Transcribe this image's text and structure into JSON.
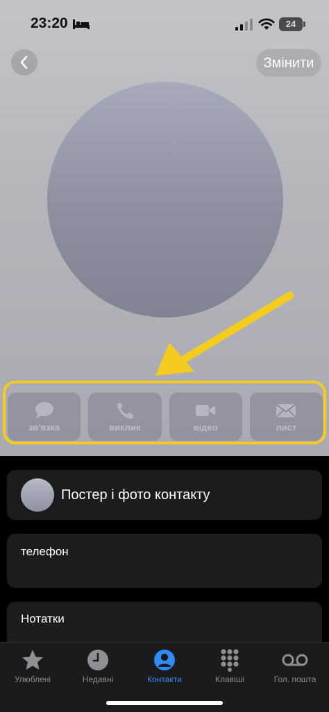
{
  "status_bar": {
    "time": "23:20",
    "battery": "24"
  },
  "header": {
    "edit_label": "Змінити"
  },
  "actions": [
    {
      "label": "зв'язка",
      "icon": "message-icon"
    },
    {
      "label": "виклик",
      "icon": "phone-icon"
    },
    {
      "label": "відео",
      "icon": "video-icon"
    },
    {
      "label": "лист",
      "icon": "mail-icon"
    }
  ],
  "cards": {
    "poster_label": "Постер і фото контакту",
    "phone_label": "телефон",
    "notes_label": "Нотатки"
  },
  "tabs": [
    {
      "label": "Улюблені",
      "icon": "star-icon",
      "active": false
    },
    {
      "label": "Недавні",
      "icon": "clock-icon",
      "active": false
    },
    {
      "label": "Контакти",
      "icon": "person-icon",
      "active": true
    },
    {
      "label": "Клавіші",
      "icon": "keypad-icon",
      "active": false
    },
    {
      "label": "Гол. пошта",
      "icon": "voicemail-icon",
      "active": false
    }
  ],
  "colors": {
    "highlight": "#f3cc1f",
    "active_tab": "#2f8cf5"
  }
}
